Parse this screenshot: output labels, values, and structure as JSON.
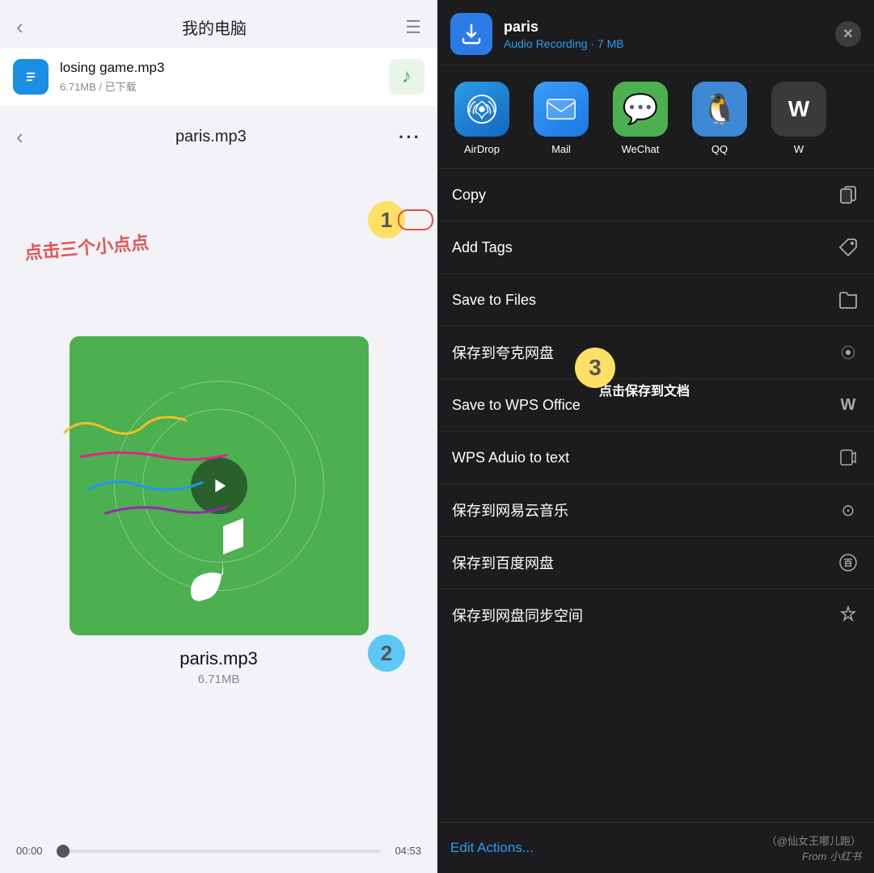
{
  "left": {
    "top_title": "我的电脑",
    "back_label": "‹",
    "menu_label": "☰",
    "file1": {
      "name": "losing game.mp3",
      "size": "6.71MB / 已下载"
    },
    "secondary_title": "paris.mp3",
    "annotation_chinese": "点击三个小点点",
    "annotation_num1": "1",
    "annotation_num2": "2",
    "album_title": "paris.mp3",
    "album_size": "6.71MB",
    "time_start": "00:00",
    "time_end": "04:53"
  },
  "right": {
    "close_label": "✕",
    "file": {
      "name": "paris",
      "subtitle": "Audio Recording · 7 MB"
    },
    "apps": [
      {
        "id": "airdrop",
        "label": "AirDrop"
      },
      {
        "id": "mail",
        "label": "Mail"
      },
      {
        "id": "wechat",
        "label": "WeChat"
      },
      {
        "id": "qq",
        "label": "QQ"
      },
      {
        "id": "more",
        "label": "W"
      }
    ],
    "actions": [
      {
        "id": "copy",
        "label": "Copy",
        "icon": "📋"
      },
      {
        "id": "add-tags",
        "label": "Add Tags",
        "icon": "🏷"
      },
      {
        "id": "save-files",
        "label": "Save to Files",
        "icon": "🗂"
      },
      {
        "id": "save-kuake",
        "label": "保存到夸克网盘",
        "icon": "⦿"
      },
      {
        "id": "save-wps",
        "label": "Save to WPS Office",
        "icon": "Ⓦ"
      },
      {
        "id": "wps-audio",
        "label": "WPS Aduio to text",
        "icon": "📊"
      },
      {
        "id": "save-netease",
        "label": "保存到网易云音乐",
        "icon": "⊙"
      },
      {
        "id": "save-baidu",
        "label": "保存到百度网盘",
        "icon": "🅱"
      },
      {
        "id": "save-tongbu",
        "label": "保存到网盘同步空间",
        "icon": "✦"
      }
    ],
    "edit_actions_label": "Edit Actions...",
    "watermark": "（@仙女王哪儿跑）",
    "watermark2": "From 小红书",
    "annotation_num3": "3",
    "annotation_save_text": "点击保存到文档"
  }
}
